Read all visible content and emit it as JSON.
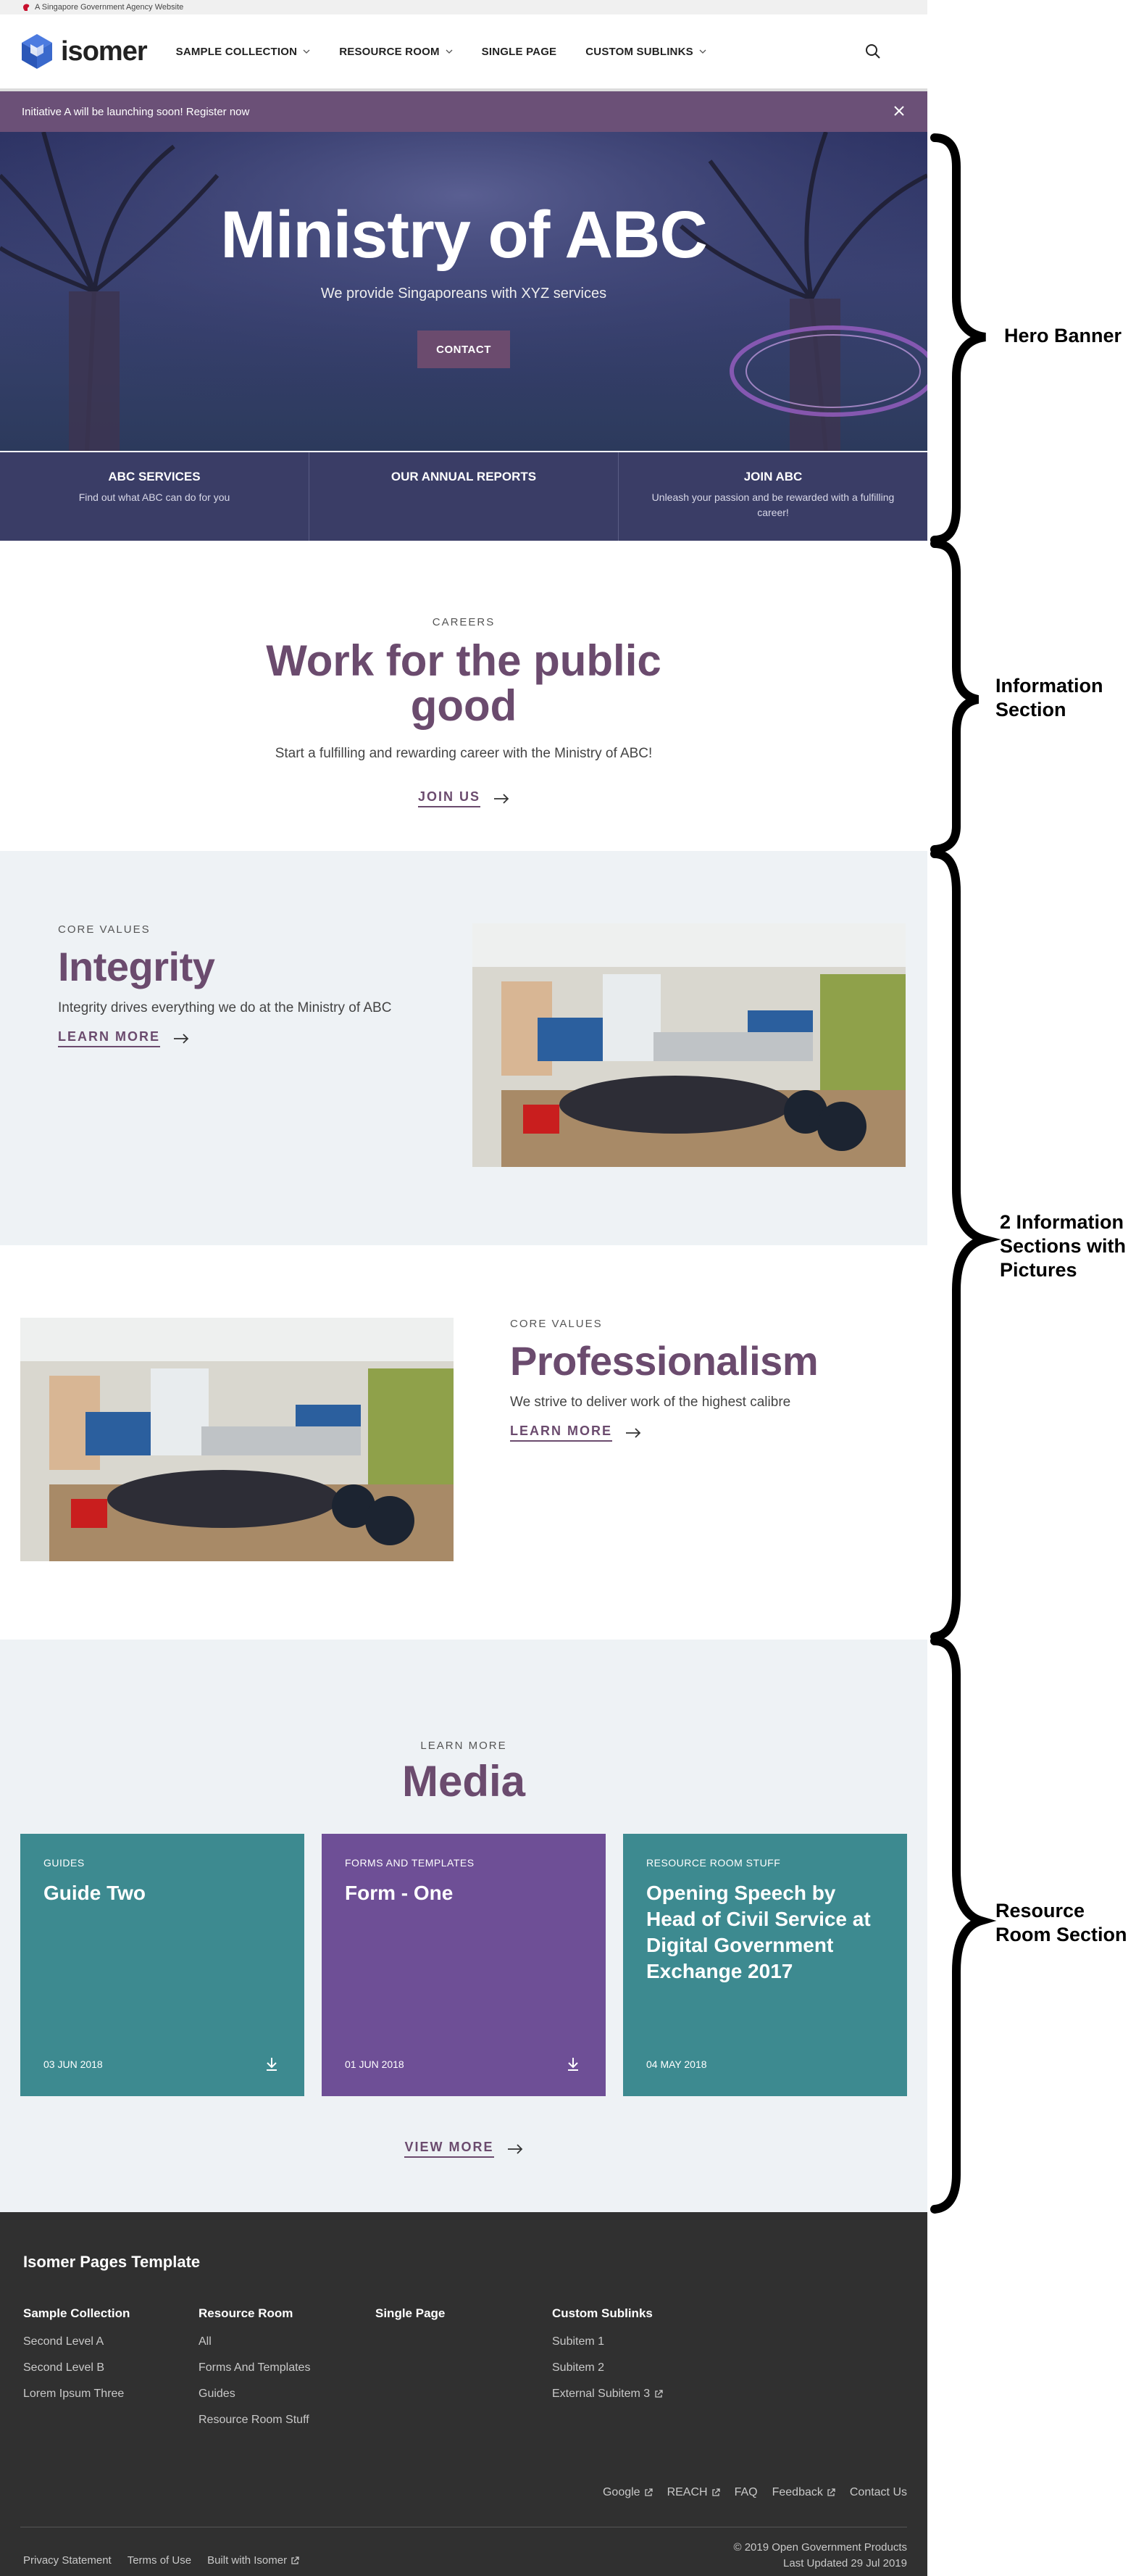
{
  "masthead": {
    "text": "A Singapore Government Agency Website"
  },
  "navbar": {
    "logo_text": "isomer",
    "items": [
      {
        "label": "SAMPLE COLLECTION",
        "dropdown": true
      },
      {
        "label": "RESOURCE ROOM",
        "dropdown": true
      },
      {
        "label": "SINGLE PAGE",
        "dropdown": false
      },
      {
        "label": "CUSTOM SUBLINKS",
        "dropdown": true
      }
    ]
  },
  "notice": {
    "text": "Initiative A will be launching soon! Register now"
  },
  "hero": {
    "title": "Ministry of ABC",
    "subtitle": "We provide Singaporeans with XYZ services",
    "button": "CONTACT",
    "key_highlights": [
      {
        "title": "ABC SERVICES",
        "description": "Find out what ABC can do for you"
      },
      {
        "title": "OUR ANNUAL REPORTS",
        "description": ""
      },
      {
        "title": "JOIN ABC",
        "description": "Unleash your passion and be rewarded with a fulfilling career!"
      }
    ]
  },
  "info": {
    "eyebrow": "CAREERS",
    "title": "Work for the public good",
    "description": "Start a fulfilling and rewarding career with the Ministry of ABC!",
    "link": "JOIN US"
  },
  "pic_sections": [
    {
      "eyebrow": "CORE VALUES",
      "title": "Integrity",
      "description": "Integrity drives everything we do at the Ministry of ABC",
      "link": "LEARN MORE"
    },
    {
      "eyebrow": "CORE VALUES",
      "title": "Professionalism",
      "description": "We strive to deliver work of the highest calibre",
      "link": "LEARN MORE"
    }
  ],
  "resource_room": {
    "eyebrow": "LEARN MORE",
    "title": "Media",
    "cards": [
      {
        "category": "GUIDES",
        "title": "Guide Two",
        "date": "03 JUN 2018",
        "download": true,
        "color": "#3d8a90"
      },
      {
        "category": "FORMS AND TEMPLATES",
        "title": "Form - One",
        "date": "01 JUN 2018",
        "download": true,
        "color": "#6e4f96"
      },
      {
        "category": "RESOURCE ROOM STUFF",
        "title": "Opening Speech by Head of Civil Service at Digital Government Exchange 2017",
        "date": "04 MAY 2018",
        "download": false,
        "color": "#3d8a90"
      }
    ],
    "link": "VIEW MORE"
  },
  "footer": {
    "brand": "Isomer Pages Template",
    "columns": [
      {
        "title": "Sample Collection",
        "items": [
          {
            "label": "Second Level A",
            "external": false
          },
          {
            "label": "Second Level B",
            "external": false
          },
          {
            "label": "Lorem Ipsum Three",
            "external": false
          }
        ]
      },
      {
        "title": "Resource Room",
        "items": [
          {
            "label": "All",
            "external": false
          },
          {
            "label": "Forms And Templates",
            "external": false
          },
          {
            "label": "Guides",
            "external": false
          },
          {
            "label": "Resource Room Stuff",
            "external": false
          }
        ]
      },
      {
        "title": "Single Page",
        "items": []
      },
      {
        "title": "Custom Sublinks",
        "items": [
          {
            "label": "Subitem 1",
            "external": false
          },
          {
            "label": "Subitem 2",
            "external": false
          },
          {
            "label": "External Subitem 3",
            "external": true
          }
        ]
      }
    ],
    "links": [
      {
        "label": "Google",
        "external": true
      },
      {
        "label": "REACH",
        "external": true
      },
      {
        "label": "FAQ",
        "external": false
      },
      {
        "label": "Feedback",
        "external": true
      },
      {
        "label": "Contact Us",
        "external": false
      }
    ],
    "legal": [
      {
        "label": "Privacy Statement",
        "external": false
      },
      {
        "label": "Terms of Use",
        "external": false
      },
      {
        "label": "Built with Isomer",
        "external": true
      }
    ],
    "copyright": "© 2019 Open Government Products",
    "last_updated": "Last Updated 29 Jul 2019"
  },
  "annotations": [
    {
      "label": "Hero Banner"
    },
    {
      "label": "Information Section"
    },
    {
      "label": "2 Information Sections with Pictures"
    },
    {
      "label": "Resource Room Section"
    }
  ],
  "colors": {
    "brand_purple": "#6b4b6e",
    "notice_bg": "#6b5077",
    "hero_highlight_bg": "#3a3d66",
    "card_teal": "#3d8a90",
    "card_purple": "#6e4f96",
    "footer_bg": "#303030",
    "section_grey": "#eef2f5"
  }
}
